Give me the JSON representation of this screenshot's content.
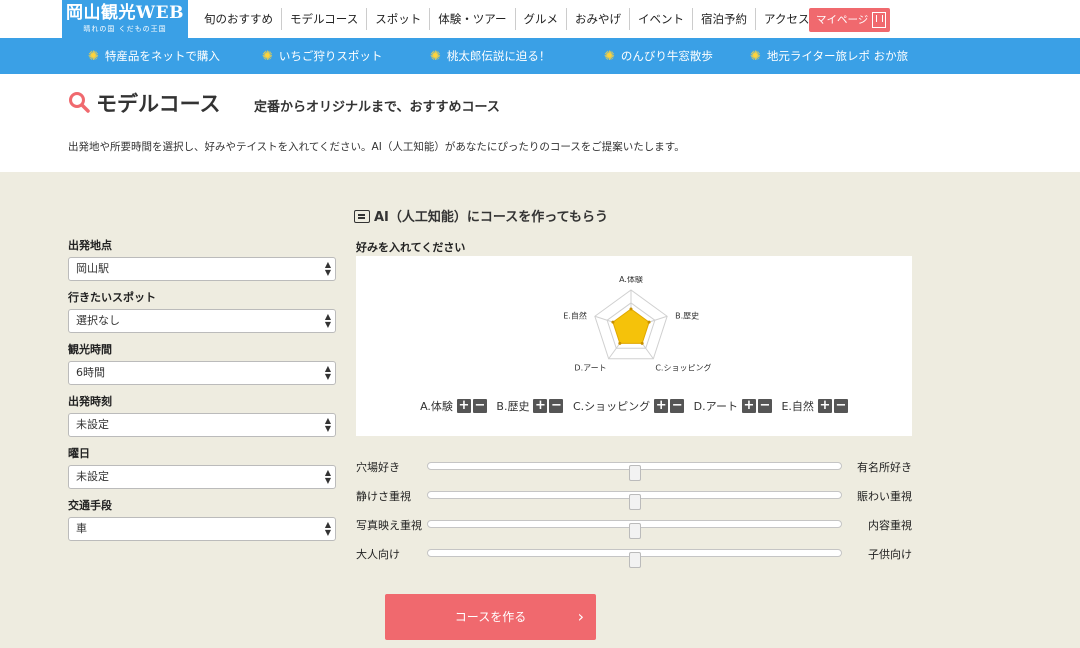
{
  "header": {
    "logo_title": "岡山観光WEB",
    "logo_subtitle": "晴れの国 くだもの王国",
    "nav": [
      "旬のおすすめ",
      "モデルコース",
      "スポット",
      "体験・ツアー",
      "グルメ",
      "おみやげ",
      "イベント",
      "宿泊予約",
      "アクセス"
    ],
    "mypage_label": "マイページ"
  },
  "subnav": [
    "特産品をネットで購入",
    "いちご狩りスポット",
    "桃太郎伝説に迫る！",
    "のんびり牛窓散歩",
    "地元ライター旅レポ おか旅"
  ],
  "page": {
    "title": "モデルコース",
    "subtitle": "定番からオリジナルまで、おすすめコース",
    "description": "出発地や所要時間を選択し、好みやテイストを入れてください。AI（人工知能）があなたにぴったりのコースをご提案いたします。"
  },
  "ai_section": {
    "title": "AI（人工知能）にコースを作ってもらう",
    "prefs_label": "好みを入れてください"
  },
  "form": {
    "fields": [
      {
        "label": "出発地点",
        "value": "岡山駅"
      },
      {
        "label": "行きたいスポット",
        "value": "選択なし"
      },
      {
        "label": "観光時間",
        "value": "6時間"
      },
      {
        "label": "出発時刻",
        "value": "未設定"
      },
      {
        "label": "曜日",
        "value": "未設定"
      },
      {
        "label": "交通手段",
        "value": "車"
      }
    ]
  },
  "radar": {
    "axes": [
      "A.体験",
      "B.歴史",
      "C.ショッピング",
      "D.アート",
      "E.自然"
    ],
    "values": [
      0.5,
      0.5,
      0.5,
      0.5,
      0.5
    ],
    "fill_color": "#f5c20a"
  },
  "radar_buttons": {
    "plus": "+",
    "minus": "−"
  },
  "sliders": [
    {
      "left": "穴場好き",
      "right": "有名所好き",
      "value": 0.5
    },
    {
      "left": "静けさ重視",
      "right": "賑わい重視",
      "value": 0.5
    },
    {
      "left": "写真映え重視",
      "right": "内容重視",
      "value": 0.5
    },
    {
      "left": "大人向け",
      "right": "子供向け",
      "value": 0.5
    }
  ],
  "create_button": {
    "label": "コースを作る"
  },
  "colors": {
    "brand_blue": "#3aa0e6",
    "accent_red": "#f0696e",
    "sun_yellow": "#ffd43b",
    "main_bg": "#eeece0"
  }
}
